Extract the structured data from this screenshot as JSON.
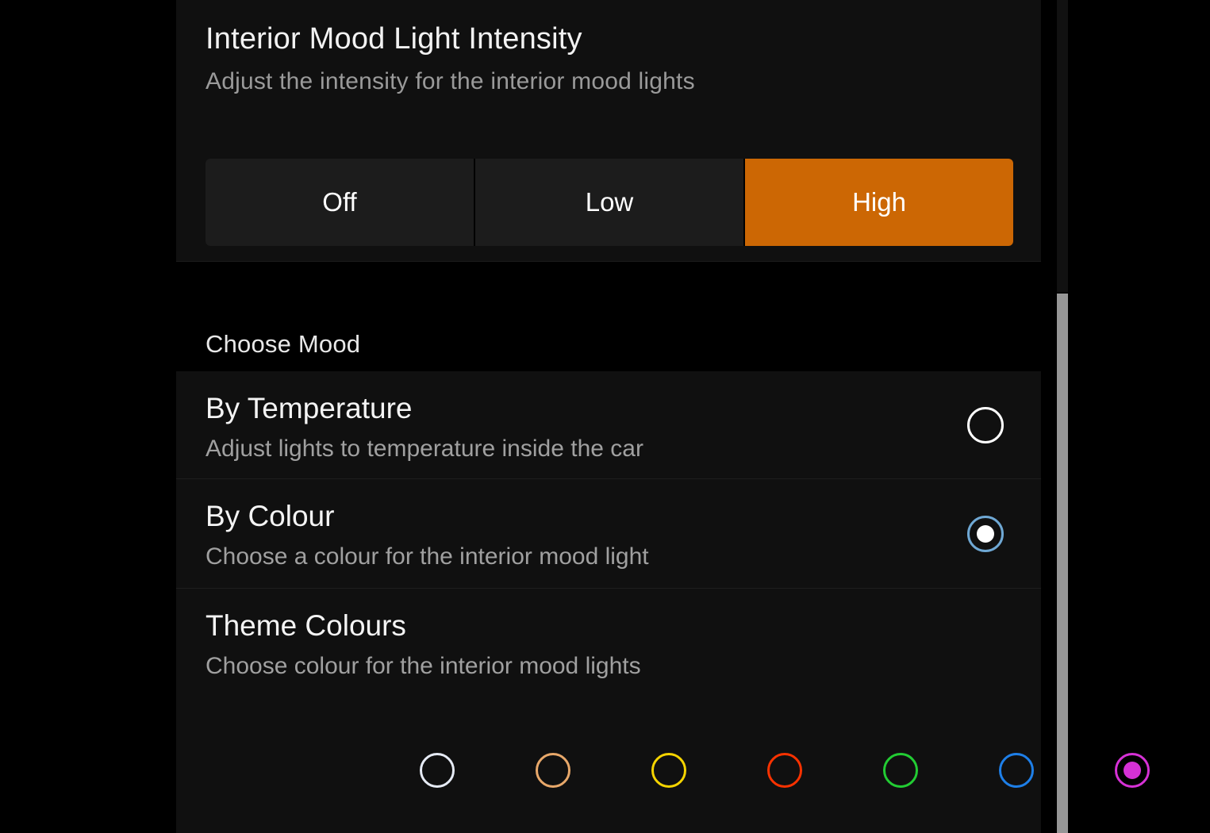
{
  "colors": {
    "accent_orange": "#cc6704",
    "page_background": "#000000",
    "card_background": "#101010",
    "segment_inactive": "#1c1c1c",
    "primary_text": "#f2f2f2",
    "secondary_text": "#9a9a9a",
    "radio_selected_ring": "#6fa8d4",
    "scrollbar_thumb": "#969696"
  },
  "intensity": {
    "title": "Interior Mood Light Intensity",
    "subtitle": "Adjust the intensity for the interior mood lights",
    "segments": [
      {
        "label": "Off",
        "selected": false
      },
      {
        "label": "Low",
        "selected": false
      },
      {
        "label": "High",
        "selected": true
      }
    ],
    "selected_segment": "High"
  },
  "choose_mood": {
    "header": "Choose Mood",
    "rows": [
      {
        "title": "By Temperature",
        "subtitle": "Adjust lights to temperature inside the car",
        "selected": false,
        "radio_name": "radio-by-temperature"
      },
      {
        "title": "By Colour",
        "subtitle": "Choose a colour for the interior mood light",
        "selected": true,
        "radio_name": "radio-by-colour"
      }
    ]
  },
  "theme_colours": {
    "title": "Theme Colours",
    "subtitle": "Choose colour for the interior mood lights",
    "swatches": [
      {
        "name": "white",
        "color": "#e6ebf5",
        "selected": false
      },
      {
        "name": "peach",
        "color": "#e8a86a",
        "selected": false
      },
      {
        "name": "yellow",
        "color": "#f5d400",
        "selected": false
      },
      {
        "name": "red",
        "color": "#fa3200",
        "selected": false
      },
      {
        "name": "green",
        "color": "#22cc33",
        "selected": false
      },
      {
        "name": "blue",
        "color": "#1e7fe8",
        "selected": false
      },
      {
        "name": "magenta",
        "color": "#d631d6",
        "selected": true
      }
    ],
    "selected_colour": "magenta"
  },
  "scrollbar": {
    "orientation": "vertical",
    "thumb_visible": true
  }
}
